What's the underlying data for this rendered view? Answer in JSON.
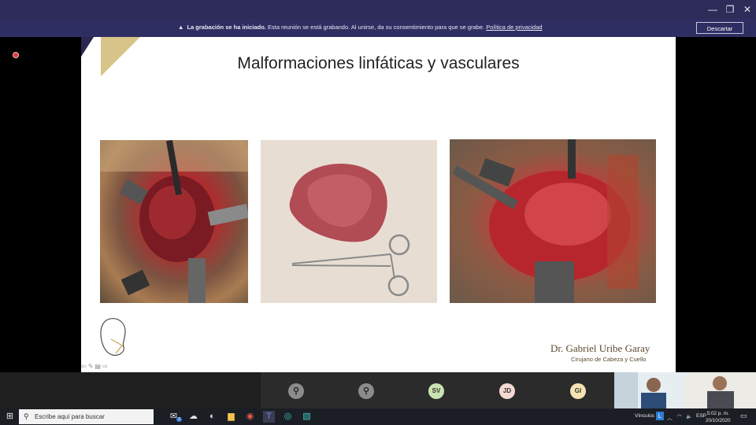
{
  "window": {
    "controls": [
      "minimize",
      "restore",
      "close"
    ]
  },
  "recording_banner": {
    "bold": "La grabación se ha iniciado.",
    "message": "Esta reunión se está grabando. Al unirse, da su consentimiento para que se grabe.",
    "link": "Política de privacidad",
    "dismiss_label": "Descartar"
  },
  "slide": {
    "title": "Malformaciones linfáticas y vasculares",
    "author": "Dr. Gabriel Uribe Garay",
    "author_subtitle": "Cirujano de Cabeza y Cuello",
    "nav": "⇦✎▤⇨"
  },
  "participants": [
    {
      "initials": "",
      "type": "icon",
      "icon": "person-icon"
    },
    {
      "initials": "",
      "type": "icon",
      "icon": "person-icon"
    },
    {
      "initials": "SV",
      "type": "initials",
      "color": "#c9e3b0"
    },
    {
      "initials": "JD",
      "type": "initials",
      "color": "#f4d9d2"
    },
    {
      "initials": "GI",
      "type": "initials",
      "color": "#f6e3b4"
    }
  ],
  "taskbar": {
    "search_placeholder": "Escribe aquí para buscar",
    "badge": "2",
    "links_label": "Vínculos",
    "language": "ESP",
    "time": "5:02 p. m.",
    "date": "20/10/2020"
  },
  "colors": {
    "accent": "#2d2c58",
    "banner": "#2f2e63"
  }
}
